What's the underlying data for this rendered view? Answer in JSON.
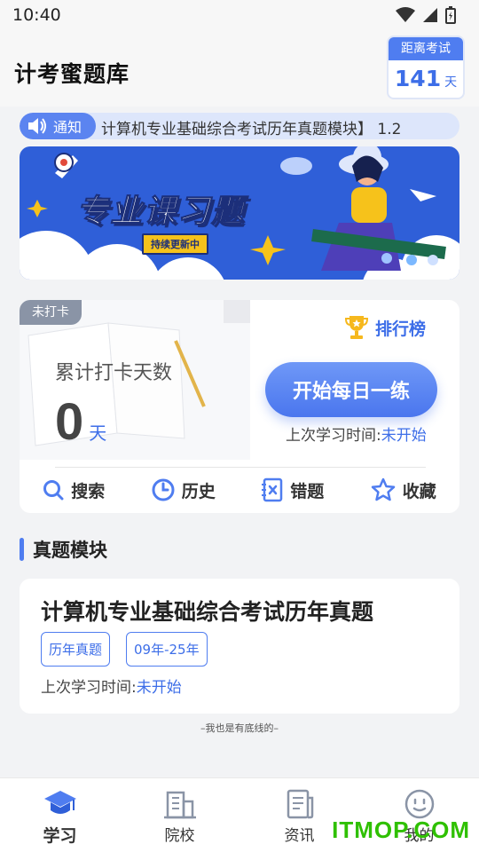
{
  "status_bar": {
    "time": "10:40"
  },
  "header": {
    "title": "计考蜜题库",
    "countdown": {
      "label": "距离考试",
      "value": "141",
      "unit": "天"
    }
  },
  "notice": {
    "tag": "通知",
    "text": "计算机专业基础综合考试历年真题模块】 1.2"
  },
  "banner": {
    "title": "专业课习题",
    "subtitle": "持续更新中"
  },
  "checkin": {
    "tag": "未打卡",
    "rank_label": "排行榜",
    "total_label": "累计打卡天数",
    "days": "0",
    "days_unit": "天",
    "start_button": "开始每日一练",
    "last_study_label": "上次学习时间:",
    "last_study_value": "未开始",
    "tools": [
      {
        "label": "搜索",
        "icon": "search-icon"
      },
      {
        "label": "历史",
        "icon": "clock-icon"
      },
      {
        "label": "错题",
        "icon": "error-notebook-icon"
      },
      {
        "label": "收藏",
        "icon": "star-icon"
      }
    ]
  },
  "section": {
    "title": "真题模块"
  },
  "exam_card": {
    "title": "计算机专业基础综合考试历年真题",
    "tags": [
      "历年真题",
      "09年-25年"
    ],
    "last_study_label": "上次学习时间:",
    "last_study_value": "未开始"
  },
  "bottom_note": "–我也是有底线的–",
  "tabbar": [
    {
      "label": "学习",
      "icon": "graduation-cap-icon",
      "active": true
    },
    {
      "label": "院校",
      "icon": "building-icon",
      "active": false
    },
    {
      "label": "资讯",
      "icon": "news-icon",
      "active": false
    },
    {
      "label": "我的",
      "icon": "smiley-icon",
      "active": false
    }
  ],
  "watermark": "ITMOP.COM",
  "colors": {
    "accent": "#4f7df0",
    "accent_text": "#3d6ee8",
    "background": "#f2f3f5"
  }
}
